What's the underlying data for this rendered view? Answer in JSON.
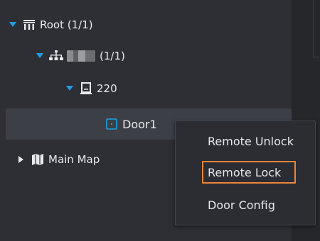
{
  "tree": {
    "root": {
      "label": "Root (1/1)",
      "icon": "org-tree-icon",
      "expanded": true
    },
    "child": {
      "label": "(1/1)",
      "icon": "network-device-icon",
      "expanded": true
    },
    "device": {
      "label": "220",
      "icon": "access-controller-icon",
      "expanded": true
    },
    "door": {
      "label": "Door1",
      "icon": "door-icon",
      "selected": true
    },
    "map": {
      "label": "Main Map",
      "icon": "map-icon",
      "expanded": false
    }
  },
  "context_menu": {
    "items": [
      {
        "label": "Remote Unlock"
      },
      {
        "label": "Remote Lock",
        "highlighted": true
      },
      {
        "label": "Door Config"
      }
    ]
  },
  "colors": {
    "accent": "#1e9fe6",
    "highlight_border": "#e8853a",
    "panel_bg": "#2d2f35",
    "selected_bg": "#3c3f46"
  }
}
